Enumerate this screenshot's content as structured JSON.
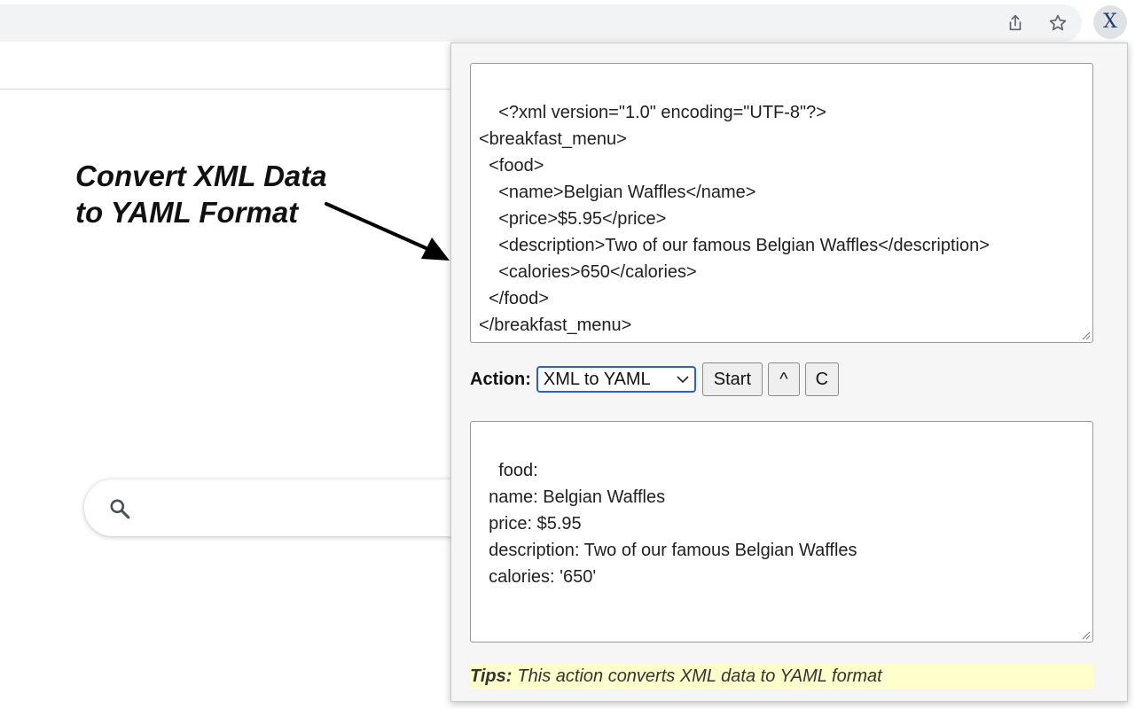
{
  "browser": {
    "toolbar_icons": [
      "share-icon",
      "star-icon"
    ],
    "extension_icon_letter": "X"
  },
  "annotation": {
    "line1": "Convert XML Data",
    "line2": "to YAML Format"
  },
  "search": {
    "icon": "search-icon"
  },
  "popup": {
    "input_text": "<?xml version=\"1.0\" encoding=\"UTF-8\"?>\n<breakfast_menu>\n  <food>\n    <name>Belgian Waffles</name>\n    <price>$5.95</price>\n    <description>Two of our famous Belgian Waffles</description>\n    <calories>650</calories>\n  </food>\n</breakfast_menu>",
    "action_label": "Action:",
    "action_selected": "XML to YAML",
    "start_label": "Start",
    "up_label": "^",
    "clear_label": "C",
    "output_text": "food:\n  name: Belgian Waffles\n  price: $5.95\n  description: Two of our famous Belgian Waffles\n  calories: '650'",
    "tips_label": "Tips:",
    "tips_text": "This action converts XML data to YAML format"
  },
  "colors": {
    "select_border": "#2c5fd4",
    "tips_background": "#ffffcc",
    "extension_letter": "#1e3a6e"
  }
}
